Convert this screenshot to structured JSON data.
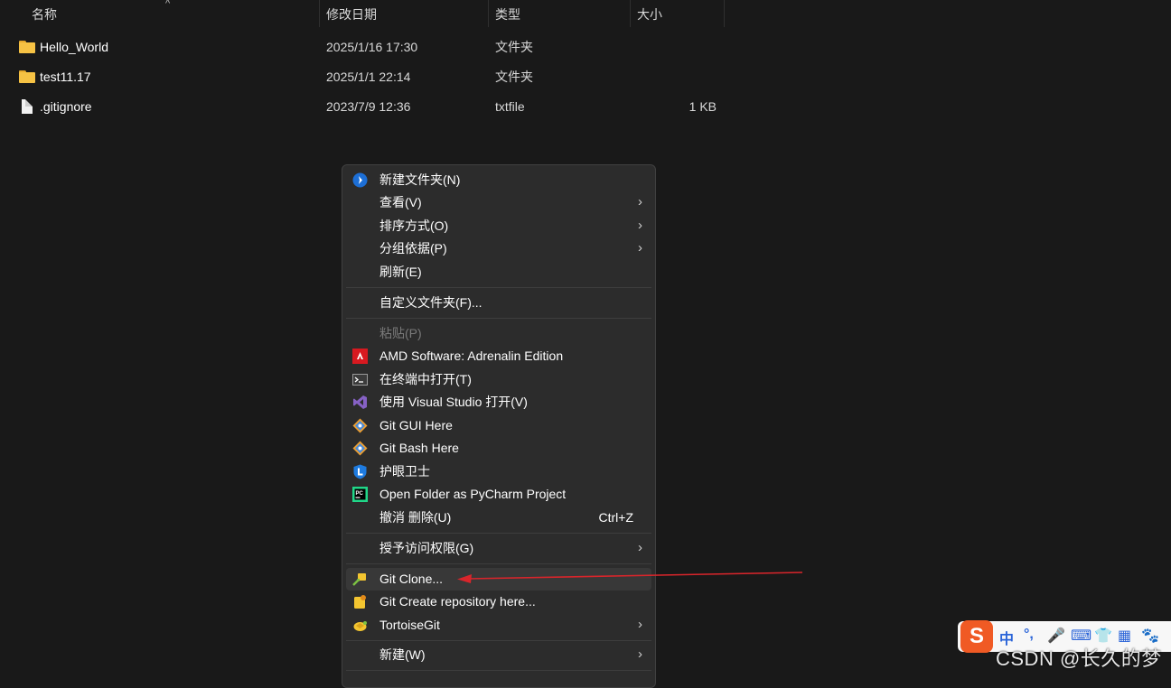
{
  "columns": {
    "name": "名称",
    "modified": "修改日期",
    "type": "类型",
    "size": "大小",
    "sort_indicator": "^"
  },
  "files": [
    {
      "name": "Hello_World",
      "date": "2025/1/16 17:30",
      "type": "文件夹",
      "size": "",
      "icon": "folder-icon"
    },
    {
      "name": "test11.17",
      "date": "2025/1/1 22:14",
      "type": "文件夹",
      "size": "",
      "icon": "folder-icon"
    },
    {
      "name": ".gitignore",
      "date": "2023/7/9 12:36",
      "type": "txtfile",
      "size": "1 KB",
      "icon": "file-icon"
    }
  ],
  "context_menu": {
    "new_folder": "新建文件夹(N)",
    "view": "查看(V)",
    "sort_by": "排序方式(O)",
    "group_by": "分组依据(P)",
    "refresh": "刷新(E)",
    "customize_folder": "自定义文件夹(F)...",
    "paste": "粘贴(P)",
    "amd_software": "AMD Software: Adrenalin Edition",
    "open_terminal": "在终端中打开(T)",
    "open_visual_studio": "使用 Visual Studio 打开(V)",
    "git_gui": "Git GUI Here",
    "git_bash": "Git Bash Here",
    "eye_guard": "护眼卫士",
    "pycharm": "Open Folder as PyCharm Project",
    "undo_delete": "撤消 删除(U)",
    "undo_shortcut": "Ctrl+Z",
    "grant_access": "授予访问权限(G)",
    "git_clone": "Git Clone...",
    "git_create_repo": "Git Create repository here...",
    "tortoisegit": "TortoiseGit",
    "new": "新建(W)",
    "chevron": "›"
  },
  "ime_toolbar": {
    "logo": "S",
    "glyphs": [
      "中",
      "°,",
      "🎤",
      "⌨",
      "👕",
      "▦",
      "🐾"
    ]
  },
  "watermark": "CSDN @长久的梦",
  "colors": {
    "background": "#191919",
    "menu_background": "#2c2c2c",
    "annotation_arrow": "#d9252b",
    "folder": "#f6c244"
  }
}
